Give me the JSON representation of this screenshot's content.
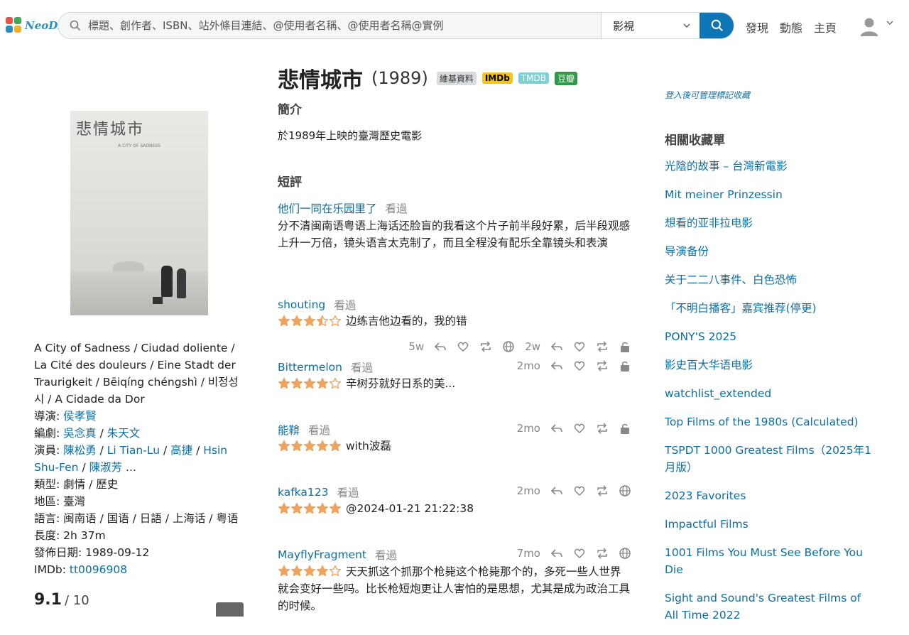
{
  "header": {
    "logo_text": "NeoDB",
    "search_placeholder": "標題、創作者、ISBN、站外條目連結、@使用者名稱、@使用者名稱@實例",
    "category": "影視",
    "nav": [
      "發現",
      "動態",
      "主頁"
    ]
  },
  "item": {
    "title": "悲情城市",
    "year": "(1989)",
    "badges": [
      "維基資料",
      "IMDb",
      "TMDB",
      "豆瓣"
    ],
    "poster_title": "悲情城市",
    "poster_subtitle": "A CITY OF SADNESS",
    "other_titles": "A City of Sadness / Ciudad doliente / La Cité des douleurs / Eine Stadt der Traurigkeit / Bēiqíng chéngshì / 비정성시 / A Cidade da Dor",
    "director_label": "導演:",
    "directors": [
      "侯孝賢"
    ],
    "writer_label": "編劇:",
    "writers": [
      "吳念真",
      "朱天文"
    ],
    "cast_label": "演員:",
    "cast": [
      "陳松勇",
      "Li Tian-Lu",
      "高捷",
      "Hsin Shu-Fen",
      "陳淑芳"
    ],
    "cast_more": " ...",
    "genre": "類型: 劇情 / 歷史",
    "region": "地區: 臺灣",
    "language": "語言: 闽南语 / 国语 / 日語 / 上海话 / 粤语",
    "length": "長度: 2h 37m",
    "release": "發佈日期: 1989-09-12",
    "imdb_label": "IMDb:",
    "imdb_id": "tt0096908",
    "rating": "9.1",
    "rating_max": "/ 10"
  },
  "intro": {
    "heading": "簡介",
    "text": "於1989年上映的臺灣歷史電影"
  },
  "reviews": {
    "heading": "短評",
    "items": [
      {
        "user": "他们一同在乐园里了",
        "status": "看過",
        "stars": 0,
        "time": "",
        "text": "分不清闽南语粤语上海话还脸盲的我看这个片子前半段好累，后半段观感上升一万倍，镜头语言太克制了，而且全程没有配乐全靠镜头和表演"
      },
      {
        "user": "shouting",
        "status": "看過",
        "stars": 3.5,
        "time": "5w",
        "text": "边练吉他边看的，我的错"
      },
      {
        "user": "Bittermelon",
        "status": "看過",
        "stars": 4,
        "time": "2mo",
        "text": "辛树芬就好日系的美..."
      },
      {
        "user": "能鞥",
        "status": "看過",
        "stars": 5,
        "time": "2mo",
        "text": "with波磊"
      },
      {
        "user": "kafka123",
        "status": "看過",
        "stars": 5,
        "time": "2mo",
        "text": "@2024-01-21 21:22:38"
      },
      {
        "user": "MayflyFragment",
        "status": "看過",
        "stars": 4,
        "time": "7mo",
        "text": "天天抓这个抓那个枪毙这个枪毙那个的，多死一些人世界就会变好一些吗。比长枪短炮更让人害怕的是思想，尤其是成为政治工具的时候。"
      }
    ],
    "action_time_first": "2w"
  },
  "sidebar": {
    "login_hint": "登入後可管理標記收藏",
    "related_heading": "相關收藏單",
    "collections": [
      "光陰的故事 – 台灣新電影",
      "Mit meiner Prinzessin",
      "想看的亚非拉电影",
      "导演备份",
      "关于二二八事件、白色恐怖",
      "「不明白播客」嘉宾推荐(停更)",
      "PONY'S 2025",
      "影史百大华语电影",
      "watchlist_extended",
      "Top Films of the 1980s (Calculated)",
      "TSPDT 1000 Greatest Films（2025年1月版）",
      "2023 Favorites",
      "Impactful Films",
      "1001 Films You Must See Before You Die",
      "Sight and Sound's Greatest Films of All Time 2022"
    ]
  },
  "colors": {
    "accent": "#0b6fa4",
    "search_button": "#0e75b6",
    "star": "#f0a35c"
  }
}
